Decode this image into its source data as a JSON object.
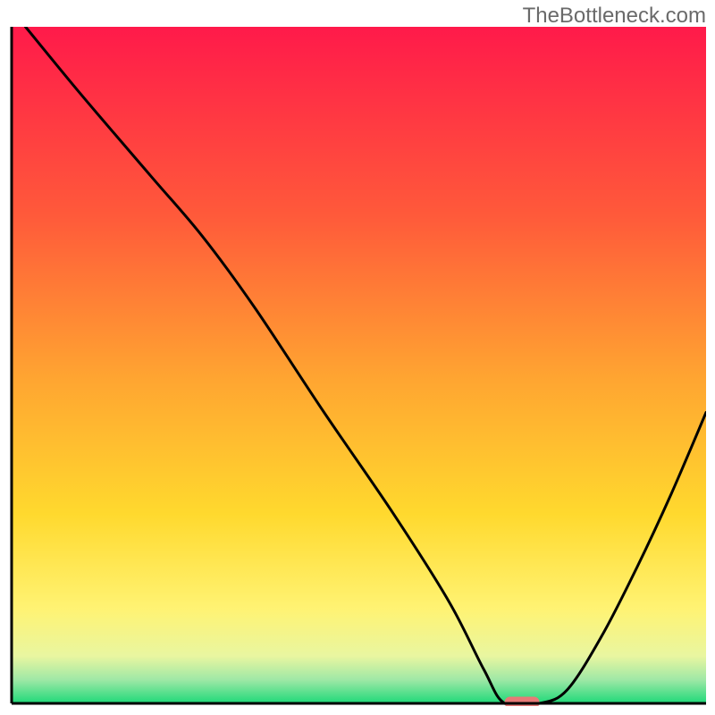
{
  "watermark": "TheBottleneck.com",
  "chart_data": {
    "type": "line",
    "title": "",
    "xlabel": "",
    "ylabel": "",
    "xlim": [
      0,
      100
    ],
    "ylim": [
      0,
      100
    ],
    "axes": {
      "left": true,
      "bottom": true,
      "right": false,
      "top": false,
      "ticks": false
    },
    "background_gradient": {
      "stops": [
        {
          "pos": 0.0,
          "color": "#ff1a4a"
        },
        {
          "pos": 0.28,
          "color": "#ff5a3a"
        },
        {
          "pos": 0.52,
          "color": "#ffa531"
        },
        {
          "pos": 0.72,
          "color": "#ffd92e"
        },
        {
          "pos": 0.86,
          "color": "#fff373"
        },
        {
          "pos": 0.93,
          "color": "#e9f6a0"
        },
        {
          "pos": 0.965,
          "color": "#9fe8a6"
        },
        {
          "pos": 1.0,
          "color": "#1fd979"
        }
      ]
    },
    "series": [
      {
        "name": "bottleneck-curve",
        "color": "#000000",
        "x": [
          2,
          10,
          20,
          27.5,
          35,
          45,
          55,
          63,
          68,
          71,
          76,
          80,
          85,
          90,
          95,
          100
        ],
        "y": [
          100,
          90,
          78,
          69,
          58.5,
          43,
          28,
          15,
          5,
          0,
          0,
          2,
          10,
          20,
          31,
          43
        ]
      }
    ],
    "marker": {
      "name": "optimal-range",
      "color": "#e77a77",
      "x_start": 71,
      "x_end": 76,
      "y": 0,
      "thickness": 2
    }
  }
}
